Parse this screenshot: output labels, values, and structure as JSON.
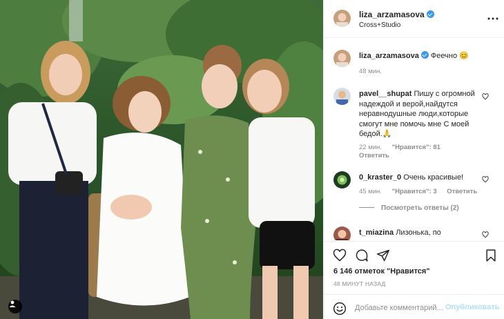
{
  "post": {
    "username": "liza_arzamasova",
    "location": "Cross+Studio",
    "caption": {
      "username": "liza_arzamasova",
      "text": "Феечно 😊",
      "time": "48 мин."
    }
  },
  "comments": [
    {
      "username": "pavel__shupat",
      "text": "Пишу с огромной надеждой и верой,найдутся неравнодушные люди,которые смогут мне помочь мне С моей бедой.🙏",
      "time": "22 мин.",
      "likes": "\"Нравится\": 81",
      "reply": "Ответить"
    },
    {
      "username": "0_kraster_0",
      "text": "Очень красивые!",
      "time": "45 мин.",
      "likes": "\"Нравится\": 3",
      "reply": "Ответить"
    },
    {
      "username": "t_miazina",
      "text": "Лизонька, по"
    }
  ],
  "view_replies": "Посмотреть ответы (2)",
  "likes_count": "6 146 отметок \"Нравится\"",
  "time_ago": "48 МИНУТ НАЗАД",
  "comment_input": {
    "placeholder": "Добавьте комментарий...",
    "post_label": "Опубликовать"
  },
  "colors": {
    "accent": "#3897f0",
    "post_disabled": "#b2dffc",
    "meta": "#8e8e8e"
  },
  "icons": [
    "user-tag-icon",
    "verified-icon",
    "more-icon",
    "heart-icon",
    "comment-icon",
    "share-icon",
    "save-icon",
    "emoji-icon"
  ]
}
